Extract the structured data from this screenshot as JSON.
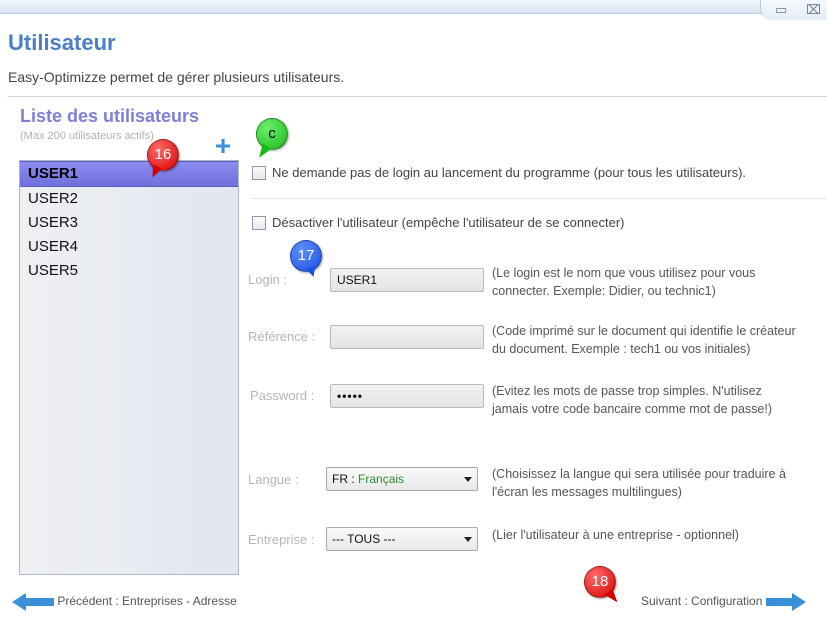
{
  "window": {
    "minimize_glyph": "▭",
    "close_glyph": "⌧"
  },
  "header": {
    "title": "Utilisateur",
    "description": "Easy-Optimizze permet de gérer plusieurs utilisateurs."
  },
  "user_list": {
    "title": "Liste des utilisateurs",
    "subtitle": "(Max 200 utilisateurs actifs)",
    "add_icon": "plus-icon",
    "items": [
      {
        "label": "USER1",
        "selected": true
      },
      {
        "label": "USER2",
        "selected": false
      },
      {
        "label": "USER3",
        "selected": false
      },
      {
        "label": "USER4",
        "selected": false
      },
      {
        "label": "USER5",
        "selected": false
      }
    ]
  },
  "options": {
    "no_login_label": "Ne demande pas de login au lancement du programme (pour tous les utilisateurs).",
    "disable_user_label": "Désactiver l'utilisateur (empêche l'utilisateur de se connecter)"
  },
  "form": {
    "login": {
      "label": "Login :",
      "value": "USER1",
      "help_line1": "(Le login est le nom que vous utilisez pour vous",
      "help_line2": "connecter. Exemple: Didier, ou technic1)"
    },
    "reference": {
      "label": "Référence :",
      "value": "",
      "help_line1": "(Code imprimé sur le document qui identifie le créateur",
      "help_line2": "du document. Exemple : tech1 ou vos initiales)"
    },
    "password": {
      "label": "Password :",
      "value": "•••••",
      "help_line1": "(Evitez les mots de passe trop simples. N'utilisez",
      "help_line2": "jamais votre code bancaire comme mot de passe!)"
    },
    "langue": {
      "label": "Langue :",
      "code": "FR :",
      "name": "Français",
      "help_line1": "(Choisissez la langue qui sera utilisée pour traduire à",
      "help_line2": "l'écran les messages multilingues)"
    },
    "entreprise": {
      "label": "Entreprise :",
      "value": "--- TOUS ---",
      "help": "(Lier l'utilisateur à une entreprise - optionnel)"
    }
  },
  "annotations": {
    "b16": "16",
    "bc": "c",
    "b17": "17",
    "b18": "18"
  },
  "navigation": {
    "prev_label": "Précédent : Entreprises - Adresse",
    "next_label": "Suivant : Configuration"
  },
  "colors": {
    "accent": "#4a7ec8",
    "list_title": "#7f7fd9",
    "selected": "#7f7fe6",
    "arrow": "#3b8fd9"
  }
}
